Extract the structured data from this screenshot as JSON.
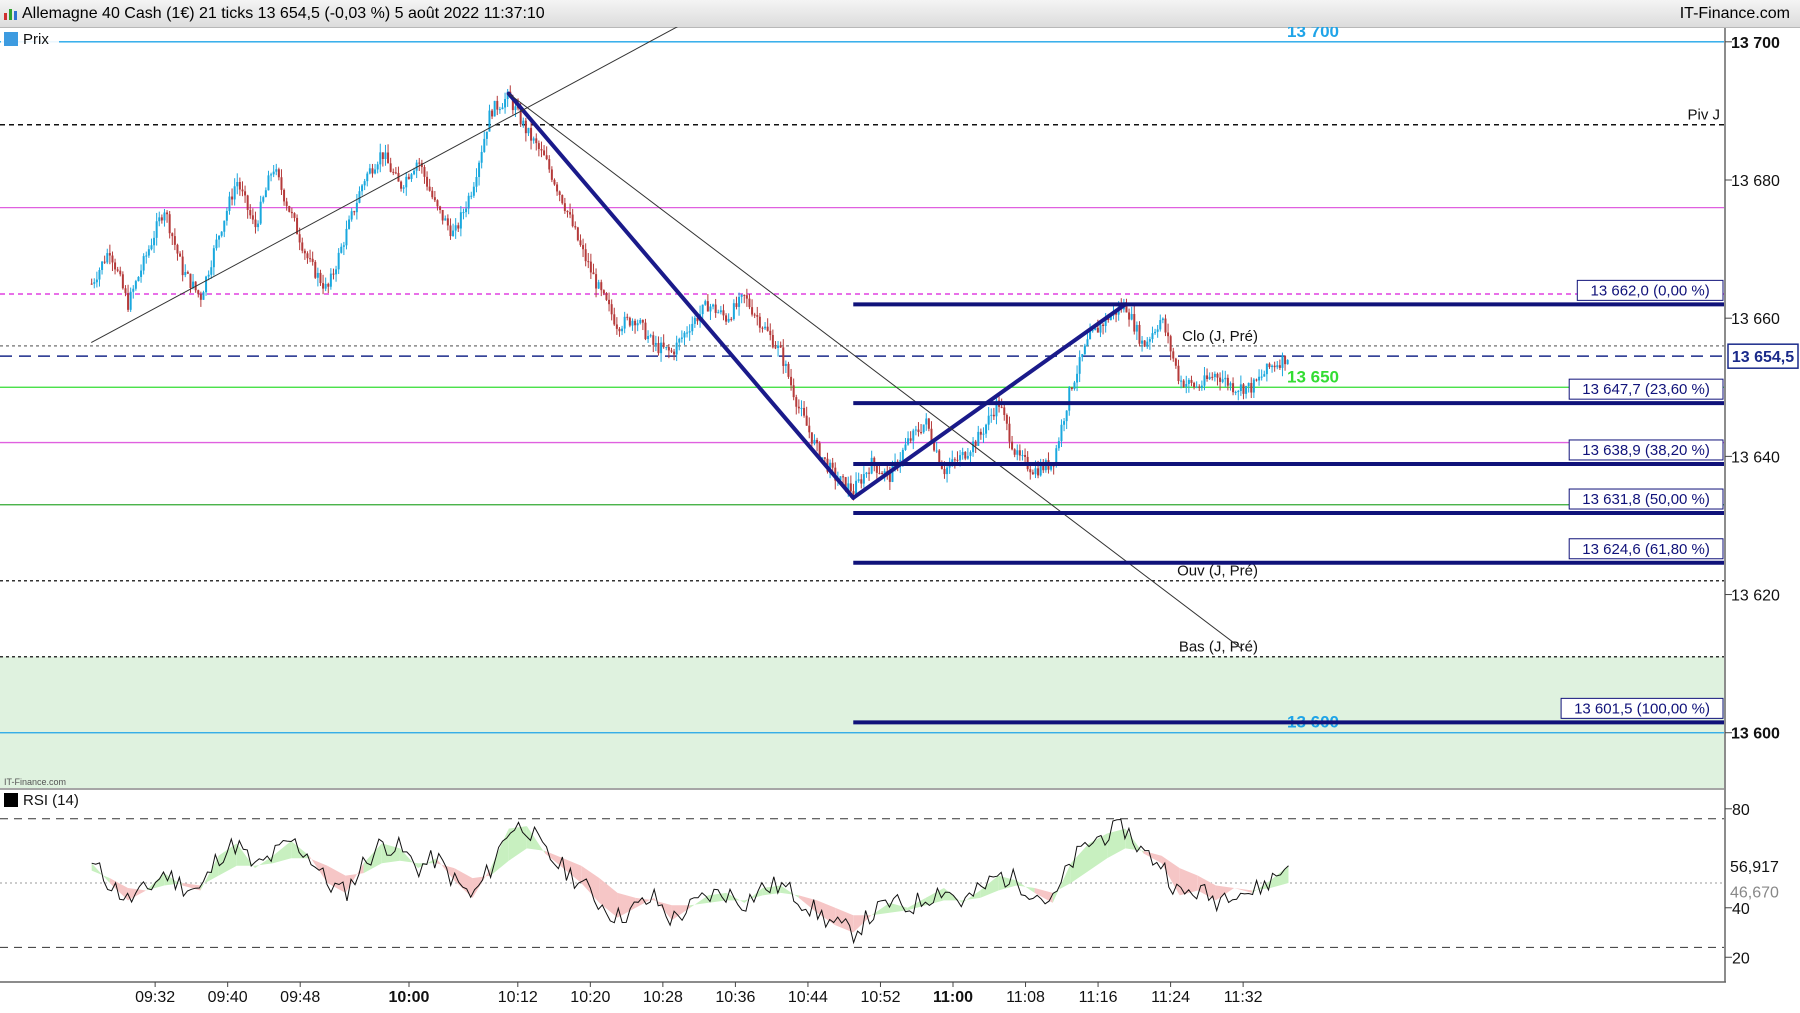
{
  "window": {
    "title": "Allemagne 40 Cash (1€) 21 ticks 13 654,5 (-0,03 %) 5 août 2022 11:37:10",
    "brand": "IT-Finance.com",
    "watermark": "IT-Finance.com"
  },
  "chart_data": [
    {
      "type": "candlestick",
      "legend": "Prix",
      "price_axis": {
        "ticks": [
          {
            "value": 13700,
            "label": "13 700",
            "bold": true
          },
          {
            "value": 13680,
            "label": "13 680"
          },
          {
            "value": 13660,
            "label": "13 660"
          },
          {
            "value": 13640,
            "label": "13 640"
          },
          {
            "value": 13620,
            "label": "13 620"
          },
          {
            "value": 13600,
            "label": "13 600",
            "bold": true
          }
        ],
        "ylim": [
          13592,
          13702
        ],
        "last_price": {
          "value": 13654.5,
          "label": "13 654,5"
        }
      },
      "time_axis": {
        "ticks": [
          {
            "t": "09:32",
            "label": "09:32"
          },
          {
            "t": "09:40",
            "label": "09:40"
          },
          {
            "t": "09:48",
            "label": "09:48"
          },
          {
            "t": "10:00",
            "label": "10:00",
            "bold": true
          },
          {
            "t": "10:12",
            "label": "10:12"
          },
          {
            "t": "10:20",
            "label": "10:20"
          },
          {
            "t": "10:28",
            "label": "10:28"
          },
          {
            "t": "10:36",
            "label": "10:36"
          },
          {
            "t": "10:44",
            "label": "10:44"
          },
          {
            "t": "10:52",
            "label": "10:52"
          },
          {
            "t": "11:00",
            "label": "11:00",
            "bold": true
          },
          {
            "t": "11:08",
            "label": "11:08"
          },
          {
            "t": "11:16",
            "label": "11:16"
          },
          {
            "t": "11:24",
            "label": "11:24"
          },
          {
            "t": "11:32",
            "label": "11:32"
          }
        ]
      },
      "price_path": [
        [
          "09:25",
          13665
        ],
        [
          "09:27",
          13670
        ],
        [
          "09:29",
          13662
        ],
        [
          "09:31",
          13669
        ],
        [
          "09:33",
          13676
        ],
        [
          "09:35",
          13667
        ],
        [
          "09:37",
          13663
        ],
        [
          "09:39",
          13672
        ],
        [
          "09:41",
          13680
        ],
        [
          "09:43",
          13673
        ],
        [
          "09:45",
          13682
        ],
        [
          "09:47",
          13675
        ],
        [
          "09:49",
          13668
        ],
        [
          "09:51",
          13664
        ],
        [
          "09:53",
          13672
        ],
        [
          "09:55",
          13680
        ],
        [
          "09:57",
          13684
        ],
        [
          "09:59",
          13679
        ],
        [
          "10:01",
          13683
        ],
        [
          "10:03",
          13676
        ],
        [
          "10:05",
          13672
        ],
        [
          "10:07",
          13679
        ],
        [
          "10:09",
          13690
        ],
        [
          "10:11",
          13692
        ],
        [
          "10:13",
          13687
        ],
        [
          "10:15",
          13683
        ],
        [
          "10:17",
          13677
        ],
        [
          "10:19",
          13670
        ],
        [
          "10:21",
          13664
        ],
        [
          "10:23",
          13659
        ],
        [
          "10:25",
          13660
        ],
        [
          "10:27",
          13656
        ],
        [
          "10:29",
          13655
        ],
        [
          "10:31",
          13659
        ],
        [
          "10:33",
          13662
        ],
        [
          "10:35",
          13660
        ],
        [
          "10:37",
          13663
        ],
        [
          "10:39",
          13659
        ],
        [
          "10:41",
          13655
        ],
        [
          "10:43",
          13647
        ],
        [
          "10:45",
          13641
        ],
        [
          "10:47",
          13637
        ],
        [
          "10:49",
          13635
        ],
        [
          "10:51",
          13639
        ],
        [
          "10:53",
          13637
        ],
        [
          "10:55",
          13642
        ],
        [
          "10:57",
          13645
        ],
        [
          "10:59",
          13638
        ],
        [
          "11:01",
          13640
        ],
        [
          "11:03",
          13643
        ],
        [
          "11:05",
          13648
        ],
        [
          "11:07",
          13640
        ],
        [
          "11:09",
          13638
        ],
        [
          "11:11",
          13639
        ],
        [
          "11:13",
          13650
        ],
        [
          "11:15",
          13657
        ],
        [
          "11:17",
          13660
        ],
        [
          "11:19",
          13662
        ],
        [
          "11:21",
          13656
        ],
        [
          "11:23",
          13660
        ],
        [
          "11:25",
          13651
        ],
        [
          "11:27",
          13650
        ],
        [
          "11:29",
          13652
        ],
        [
          "11:31",
          13650
        ],
        [
          "11:33",
          13650
        ],
        [
          "11:35",
          13653
        ],
        [
          "11:37",
          13654.5
        ]
      ],
      "horizontal_levels": [
        {
          "value": 13700,
          "label": "13 700",
          "color": "#1fa4e8"
        },
        {
          "value": 13600,
          "label": "13 600",
          "color": "#1fa4e8"
        },
        {
          "value": 13650,
          "label": "13 650",
          "color": "#33dd33"
        },
        {
          "value": 13688,
          "label": "Piv J",
          "color": "#111111",
          "dash": "5,4"
        },
        {
          "value": 13676,
          "label": "",
          "color": "#e060e0"
        },
        {
          "value": 13663.5,
          "label": "",
          "color": "#e040e0",
          "dash": "5,4"
        },
        {
          "value": 13642,
          "label": "",
          "color": "#e060e0"
        },
        {
          "value": 13633,
          "label": "",
          "color": "#33aa33"
        },
        {
          "value": 13656,
          "label": "Clo (J, Pré)",
          "color": "#888888",
          "dash": "3,3"
        },
        {
          "value": 13654.5,
          "label": "",
          "color": "#1a2a8a",
          "dash": "12,7"
        },
        {
          "value": 13622,
          "label": "Ouv (J, Pré)",
          "color": "#333333",
          "dash": "3,3"
        },
        {
          "value": 13611,
          "label": "Bas (J, Pré)",
          "color": "#333333",
          "dash": "3,3"
        }
      ],
      "zone": {
        "from": 13592,
        "to": 13611,
        "color": "#dff2df"
      },
      "fibonacci": {
        "from_time": "10:49",
        "levels": [
          {
            "value": 13662.0,
            "label": "13 662,0 (0,00 %)"
          },
          {
            "value": 13647.7,
            "label": "13 647,7 (23,60 %)"
          },
          {
            "value": 13638.9,
            "label": "13 638,9 (38,20 %)"
          },
          {
            "value": 13631.8,
            "label": "13 631,8 (50,00 %)"
          },
          {
            "value": 13624.6,
            "label": "13 624,6 (61,80 %)"
          },
          {
            "value": 13601.5,
            "label": "13 601,5 (100,00 %)"
          }
        ]
      },
      "trend_lines": [
        {
          "from": [
            "10:11",
            13692.5
          ],
          "to": [
            "10:49",
            13634
          ],
          "width": 4,
          "color": "#1a1a8a"
        },
        {
          "from": [
            "10:49",
            13634
          ],
          "to": [
            "11:19",
            13662
          ],
          "width": 4,
          "color": "#1a1a8a"
        },
        {
          "from": [
            "09:25",
            13656.5
          ],
          "to": [
            "10:35",
            13706
          ],
          "width": 1,
          "color": "#333333"
        },
        {
          "from": [
            "10:11",
            13692.5
          ],
          "to": [
            "11:32",
            13612
          ],
          "width": 1,
          "color": "#333333"
        }
      ]
    },
    {
      "type": "line",
      "legend": "RSI (14)",
      "ylim": [
        10,
        88
      ],
      "ticks": [
        {
          "value": 80,
          "label": "80"
        },
        {
          "value": 40,
          "label": "40"
        },
        {
          "value": 20,
          "label": "20"
        }
      ],
      "bands": [
        76,
        24
      ],
      "midline": 50,
      "last_value": {
        "value": 56.917,
        "label": "56,917"
      },
      "signal_value": {
        "value": 46.67,
        "label": "46,670"
      },
      "series": [
        58,
        50,
        43,
        47,
        54,
        49,
        47,
        61,
        66,
        56,
        61,
        67,
        61,
        50,
        46,
        58,
        66,
        64,
        56,
        60,
        51,
        44,
        56,
        72,
        73,
        62,
        56,
        50,
        42,
        36,
        40,
        44,
        35,
        40,
        45,
        46,
        42,
        48,
        49,
        44,
        38,
        33,
        30,
        37,
        42,
        40,
        44,
        48,
        42,
        47,
        53,
        51,
        46,
        42,
        58,
        66,
        70,
        72,
        62,
        58,
        45,
        47,
        43,
        48,
        46,
        51,
        57
      ],
      "signal": [
        55,
        52,
        48,
        47,
        49,
        50,
        49,
        53,
        57,
        57,
        58,
        60,
        60,
        57,
        53,
        54,
        58,
        59,
        58,
        58,
        56,
        52,
        53,
        59,
        64,
        63,
        60,
        57,
        52,
        46,
        44,
        43,
        41,
        41,
        42,
        43,
        43,
        45,
        46,
        45,
        43,
        40,
        37,
        37,
        38,
        39,
        41,
        43,
        43,
        44,
        47,
        49,
        48,
        46,
        50,
        55,
        60,
        64,
        63,
        61,
        56,
        53,
        49,
        48,
        47,
        48,
        50
      ]
    }
  ]
}
